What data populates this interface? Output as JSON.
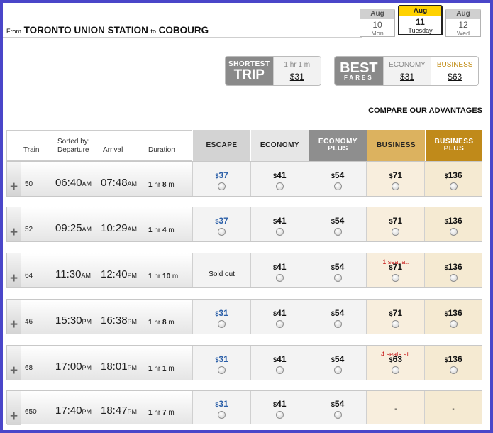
{
  "route": {
    "from_label": "From",
    "origin": "TORONTO UNION STATION",
    "to_label": "to",
    "destination": "COBOURG"
  },
  "date_tabs": [
    {
      "month": "Aug",
      "day": "10",
      "weekday": "Mon",
      "active": false
    },
    {
      "month": "Aug",
      "day": "11",
      "weekday": "Tuesday",
      "active": true
    },
    {
      "month": "Aug",
      "day": "12",
      "weekday": "Wed",
      "active": false
    }
  ],
  "shortest_trip": {
    "logo_line1": "SHORTEST",
    "logo_line2": "TRIP",
    "duration": "1 hr 1 m",
    "fare": "$31"
  },
  "best_fares": {
    "logo_line1": "BEST",
    "logo_line2": "FARES",
    "economy_label": "ECONOMY",
    "economy_fare": "$31",
    "business_label": "BUSINESS",
    "business_fare": "$63"
  },
  "compare_link": "COMPARE OUR ADVANTAGES",
  "table": {
    "headers": {
      "train": "Train",
      "sorted_by": "Sorted by:",
      "departure": "Departure",
      "arrival": "Arrival",
      "duration": "Duration"
    },
    "fare_classes": [
      {
        "line1": "ESCAPE",
        "line2": ""
      },
      {
        "line1": "ECONOMY",
        "line2": ""
      },
      {
        "line1": "ECONOMY",
        "line2": "PLUS"
      },
      {
        "line1": "BUSINESS",
        "line2": ""
      },
      {
        "line1": "BUSINESS",
        "line2": "PLUS"
      }
    ],
    "rows": [
      {
        "train": "50",
        "dep": "06:40",
        "dep_ap": "AM",
        "arr": "07:48",
        "arr_ap": "AM",
        "dur_h": "1",
        "dur_m": "8",
        "fares": [
          {
            "price": "37",
            "note": ""
          },
          {
            "price": "41",
            "note": ""
          },
          {
            "price": "54",
            "note": ""
          },
          {
            "price": "71",
            "note": ""
          },
          {
            "price": "136",
            "note": ""
          }
        ]
      },
      {
        "train": "52",
        "dep": "09:25",
        "dep_ap": "AM",
        "arr": "10:29",
        "arr_ap": "AM",
        "dur_h": "1",
        "dur_m": "4",
        "fares": [
          {
            "price": "37",
            "note": ""
          },
          {
            "price": "41",
            "note": ""
          },
          {
            "price": "54",
            "note": ""
          },
          {
            "price": "71",
            "note": ""
          },
          {
            "price": "136",
            "note": ""
          }
        ]
      },
      {
        "train": "64",
        "dep": "11:30",
        "dep_ap": "AM",
        "arr": "12:40",
        "arr_ap": "PM",
        "dur_h": "1",
        "dur_m": "10",
        "fares": [
          {
            "price": "",
            "note": "",
            "text": "Sold out"
          },
          {
            "price": "41",
            "note": ""
          },
          {
            "price": "54",
            "note": ""
          },
          {
            "price": "71",
            "note": "1 seat at:"
          },
          {
            "price": "136",
            "note": ""
          }
        ]
      },
      {
        "train": "46",
        "dep": "15:30",
        "dep_ap": "PM",
        "arr": "16:38",
        "arr_ap": "PM",
        "dur_h": "1",
        "dur_m": "8",
        "fares": [
          {
            "price": "31",
            "note": ""
          },
          {
            "price": "41",
            "note": ""
          },
          {
            "price": "54",
            "note": ""
          },
          {
            "price": "71",
            "note": ""
          },
          {
            "price": "136",
            "note": ""
          }
        ]
      },
      {
        "train": "68",
        "dep": "17:00",
        "dep_ap": "PM",
        "arr": "18:01",
        "arr_ap": "PM",
        "dur_h": "1",
        "dur_m": "1",
        "fares": [
          {
            "price": "31",
            "note": ""
          },
          {
            "price": "41",
            "note": ""
          },
          {
            "price": "54",
            "note": ""
          },
          {
            "price": "63",
            "note": "4 seats at:"
          },
          {
            "price": "136",
            "note": ""
          }
        ]
      },
      {
        "train": "650",
        "dep": "17:40",
        "dep_ap": "PM",
        "arr": "18:47",
        "arr_ap": "PM",
        "dur_h": "1",
        "dur_m": "7",
        "fares": [
          {
            "price": "31",
            "note": ""
          },
          {
            "price": "41",
            "note": ""
          },
          {
            "price": "54",
            "note": ""
          },
          {
            "price": "",
            "note": "",
            "text": "-"
          },
          {
            "price": "",
            "note": "",
            "text": "-"
          }
        ]
      }
    ]
  },
  "colors": {
    "frame": "#4a46c9",
    "escape_header": "#d3d3d3",
    "economy_header": "#e6e6e6",
    "economy_plus_header": "#8e8e8e",
    "business_header": "#dcb25f",
    "business_plus_header": "#c08a1a",
    "escape_price": "#2b5fa8",
    "seat_note": "#c81c1c"
  }
}
